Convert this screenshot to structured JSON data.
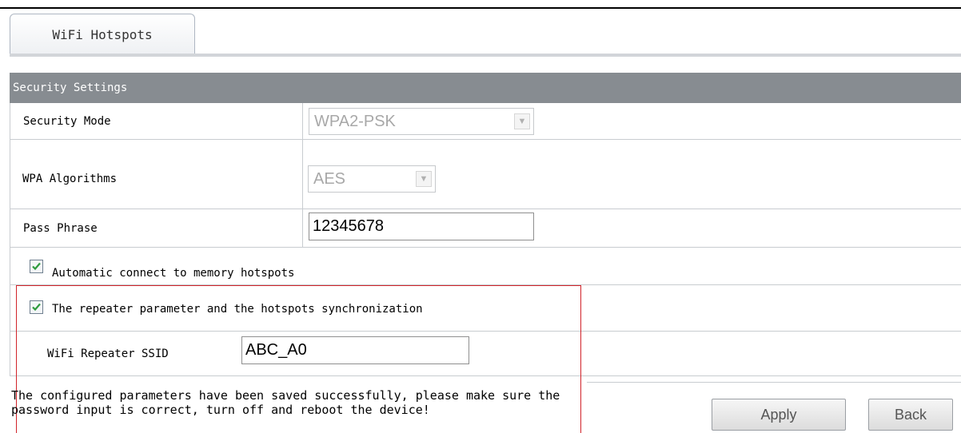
{
  "tabs": [
    {
      "label": "WiFi Hotspots",
      "active": true
    }
  ],
  "section": {
    "title": "Security Settings"
  },
  "fields": {
    "security_mode": {
      "label": "Security Mode",
      "value": "WPA2-PSK",
      "disabled": true
    },
    "wpa_algorithms": {
      "label": "WPA Algorithms",
      "value": "AES",
      "disabled": true
    },
    "pass_phrase": {
      "label": "Pass Phrase",
      "value": "12345678"
    }
  },
  "options": {
    "auto_connect": {
      "label": "Automatic connect to memory hotspots",
      "checked": true
    },
    "repeater_sync": {
      "label": "The repeater parameter and the hotspots synchronization",
      "checked": true
    }
  },
  "repeater_ssid": {
    "label": "WiFi Repeater SSID",
    "value": "ABC_A0"
  },
  "status_message": "The configured parameters have been saved successfully, please make sure the password input is correct, turn off and reboot the device!",
  "buttons": {
    "apply": "Apply",
    "back": "Back"
  },
  "colors": {
    "header_bg": "#878c91",
    "highlight_border": "#d1232a",
    "checkmark": "#2e9b3e"
  }
}
